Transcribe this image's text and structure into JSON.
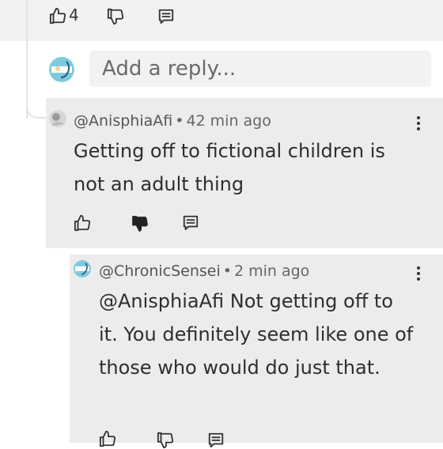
{
  "top_actions": {
    "like_count": "4"
  },
  "reply": {
    "placeholder": "Add a reply..."
  },
  "comments": [
    {
      "username": "@AnisphiaAfi",
      "separator": "•",
      "time": "42 min ago",
      "text": "Getting off to fictional children is not an adult thing"
    },
    {
      "username": "@ChronicSensei",
      "separator": "•",
      "time": "2 min ago",
      "text": "@AnisphiaAfi Not getting off to it. You definitely seem like one of those who would do just that."
    }
  ],
  "icons": {
    "like": "thumbs-up-icon",
    "dislike": "thumbs-down-icon",
    "reply": "comment-icon",
    "more": "kebab-menu-icon"
  }
}
